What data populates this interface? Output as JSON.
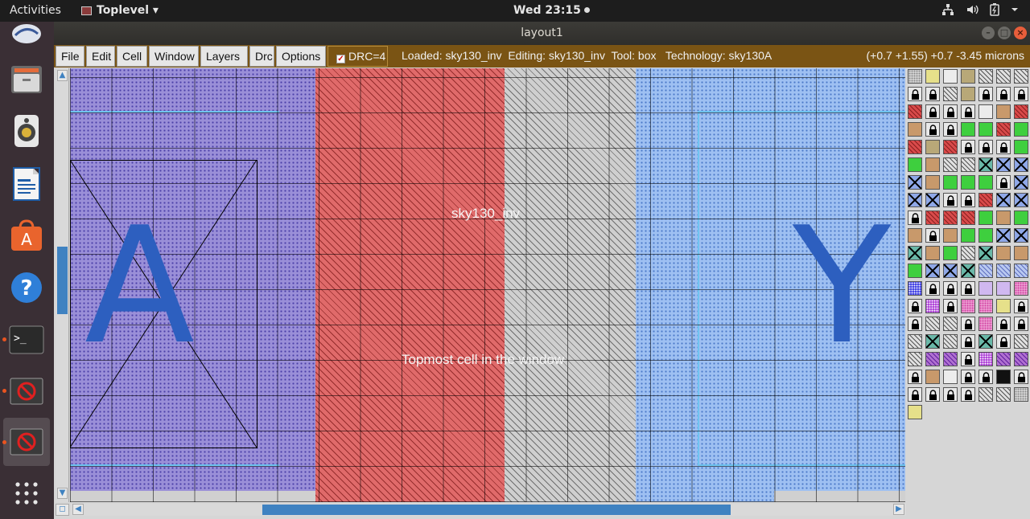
{
  "topbar": {
    "activities": "Activities",
    "app_name": "Toplevel ▾",
    "clock": "Wed 23:15"
  },
  "window": {
    "title": "layout1"
  },
  "menu": {
    "items": [
      "File",
      "Edit",
      "Cell",
      "Window",
      "Layers",
      "Drc",
      "Options"
    ],
    "drc_label": "DRC=4",
    "drc_checked": true,
    "status": "Loaded: sky130_inv  Editing: sky130_inv  Tool: box   Technology: sky130A",
    "coords": "(+0.7 +1.55) +0.7 -3.45 microns"
  },
  "canvas": {
    "cell_name": "sky130_inv",
    "cell_caption": "Topmost cell in the window",
    "label_a": "A",
    "label_y": "Y"
  },
  "dock": {
    "items": [
      "files-icon",
      "rhythmbox-icon",
      "writer-icon",
      "software-center-icon",
      "help-icon",
      "terminal-icon",
      "magic-icon",
      "magic-active-icon",
      "app-grid-icon"
    ]
  },
  "colors": {
    "menubar": "#7a5414",
    "pwell": "#9a8fd8",
    "poly": "#e06a6a",
    "diffusion": "#cfcfcf",
    "nwell": "#9ec0f2",
    "label_blue": "#2d5fbf",
    "scroll_thumb": "#3f82c1"
  }
}
